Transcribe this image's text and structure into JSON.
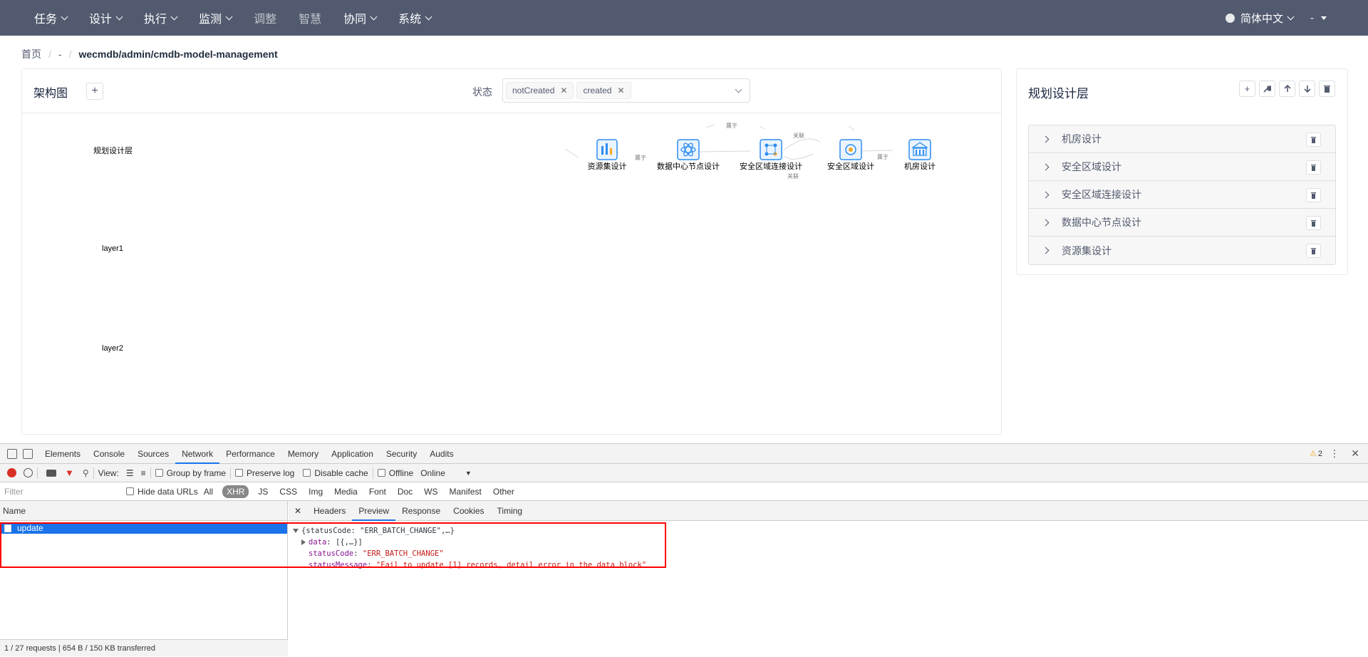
{
  "nav": {
    "items": [
      {
        "label": "任务",
        "dropdown": true
      },
      {
        "label": "设计",
        "dropdown": true
      },
      {
        "label": "执行",
        "dropdown": true
      },
      {
        "label": "监测",
        "dropdown": true
      },
      {
        "label": "调整",
        "dropdown": false
      },
      {
        "label": "智慧",
        "dropdown": false
      },
      {
        "label": "协同",
        "dropdown": true
      },
      {
        "label": "系统",
        "dropdown": true
      }
    ],
    "language": "简体中文",
    "user": "-"
  },
  "breadcrumb": {
    "home": "首页",
    "middle": "-",
    "current": "wecmdb/admin/cmdb-model-management"
  },
  "graph_panel": {
    "title": "架构图",
    "add_label": "+",
    "status_label": "状态",
    "status_tags": [
      "notCreated",
      "created"
    ],
    "layers": [
      "规划设计层",
      "layer1",
      "layer2"
    ],
    "nodes": [
      "资源集设计",
      "数据中心节点设计",
      "安全区域连接设计",
      "安全区域设计",
      "机房设计"
    ],
    "edge_labels": [
      "属于",
      "属于",
      "关联",
      "关联",
      "属于"
    ]
  },
  "layer_panel": {
    "title": "规划设计层",
    "tools": [
      "plus-icon",
      "wrench-icon",
      "arrow-up-icon",
      "arrow-down-icon",
      "trash-icon"
    ],
    "items": [
      "机房设计",
      "安全区域设计",
      "安全区域连接设计",
      "数据中心节点设计",
      "资源集设计"
    ]
  },
  "devtools": {
    "tabs": [
      "Elements",
      "Console",
      "Sources",
      "Network",
      "Performance",
      "Memory",
      "Application",
      "Security",
      "Audits"
    ],
    "active_tab": "Network",
    "warnings": "2",
    "toolbar": {
      "view": "View:",
      "group_by_frame": "Group by frame",
      "preserve_log": "Preserve log",
      "disable_cache": "Disable cache",
      "offline": "Offline",
      "online": "Online"
    },
    "filter_placeholder": "Filter",
    "hide_data_urls": "Hide data URLs",
    "types": [
      "All",
      "XHR",
      "JS",
      "CSS",
      "Img",
      "Media",
      "Font",
      "Doc",
      "WS",
      "Manifest",
      "Other"
    ],
    "active_type": "XHR",
    "name_header": "Name",
    "requests": [
      "update"
    ],
    "footer": "1 / 27 requests  |  654 B / 150 KB transferred",
    "detail_tabs": [
      "Headers",
      "Preview",
      "Response",
      "Cookies",
      "Timing"
    ],
    "active_detail": "Preview",
    "preview": {
      "root": "{statusCode: \"ERR_BATCH_CHANGE\",…}",
      "data_key": "data",
      "data_val": "[{,…}]",
      "status_code_key": "statusCode",
      "status_code_val": "\"ERR_BATCH_CHANGE\"",
      "status_message_key": "statusMessage",
      "status_message_val": "\"Fail to update [1] records, detail error in the data block\""
    }
  },
  "colors": {
    "nav_bg": "#515a6e",
    "accent": "#1a73e8",
    "highlight_box": "#ff0000",
    "node_icon": "#2d8cf0"
  }
}
